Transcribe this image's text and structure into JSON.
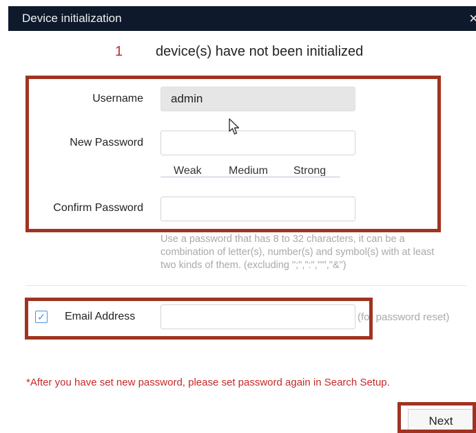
{
  "window": {
    "title": "Device initialization",
    "close_glyph": "×"
  },
  "notice": {
    "count": "1",
    "message": "device(s) have not been initialized"
  },
  "form": {
    "username_label": "Username",
    "username_value": "admin",
    "new_password_label": "New Password",
    "new_password_value": "",
    "strength_levels": [
      "Weak",
      "Medium",
      "Strong"
    ],
    "confirm_password_label": "Confirm Password",
    "confirm_password_value": "",
    "password_hint": "Use a password that has 8 to 32 characters, it can be a combination of letter(s), number(s) and symbol(s) with at least two kinds of them. (excluding \";\",\":\",\"'\",\"&\")"
  },
  "email": {
    "checked": true,
    "check_glyph": "✓",
    "label": "Email Address",
    "value": "",
    "hint": "(for password reset)"
  },
  "warning": "*After you have set new password, please set password again in Search Setup.",
  "actions": {
    "next_label": "Next"
  },
  "colors": {
    "title_bar": "#0e1a2b",
    "warning": "#c62828",
    "annotation": "#a03320",
    "checkbox": "#4a90e2"
  }
}
